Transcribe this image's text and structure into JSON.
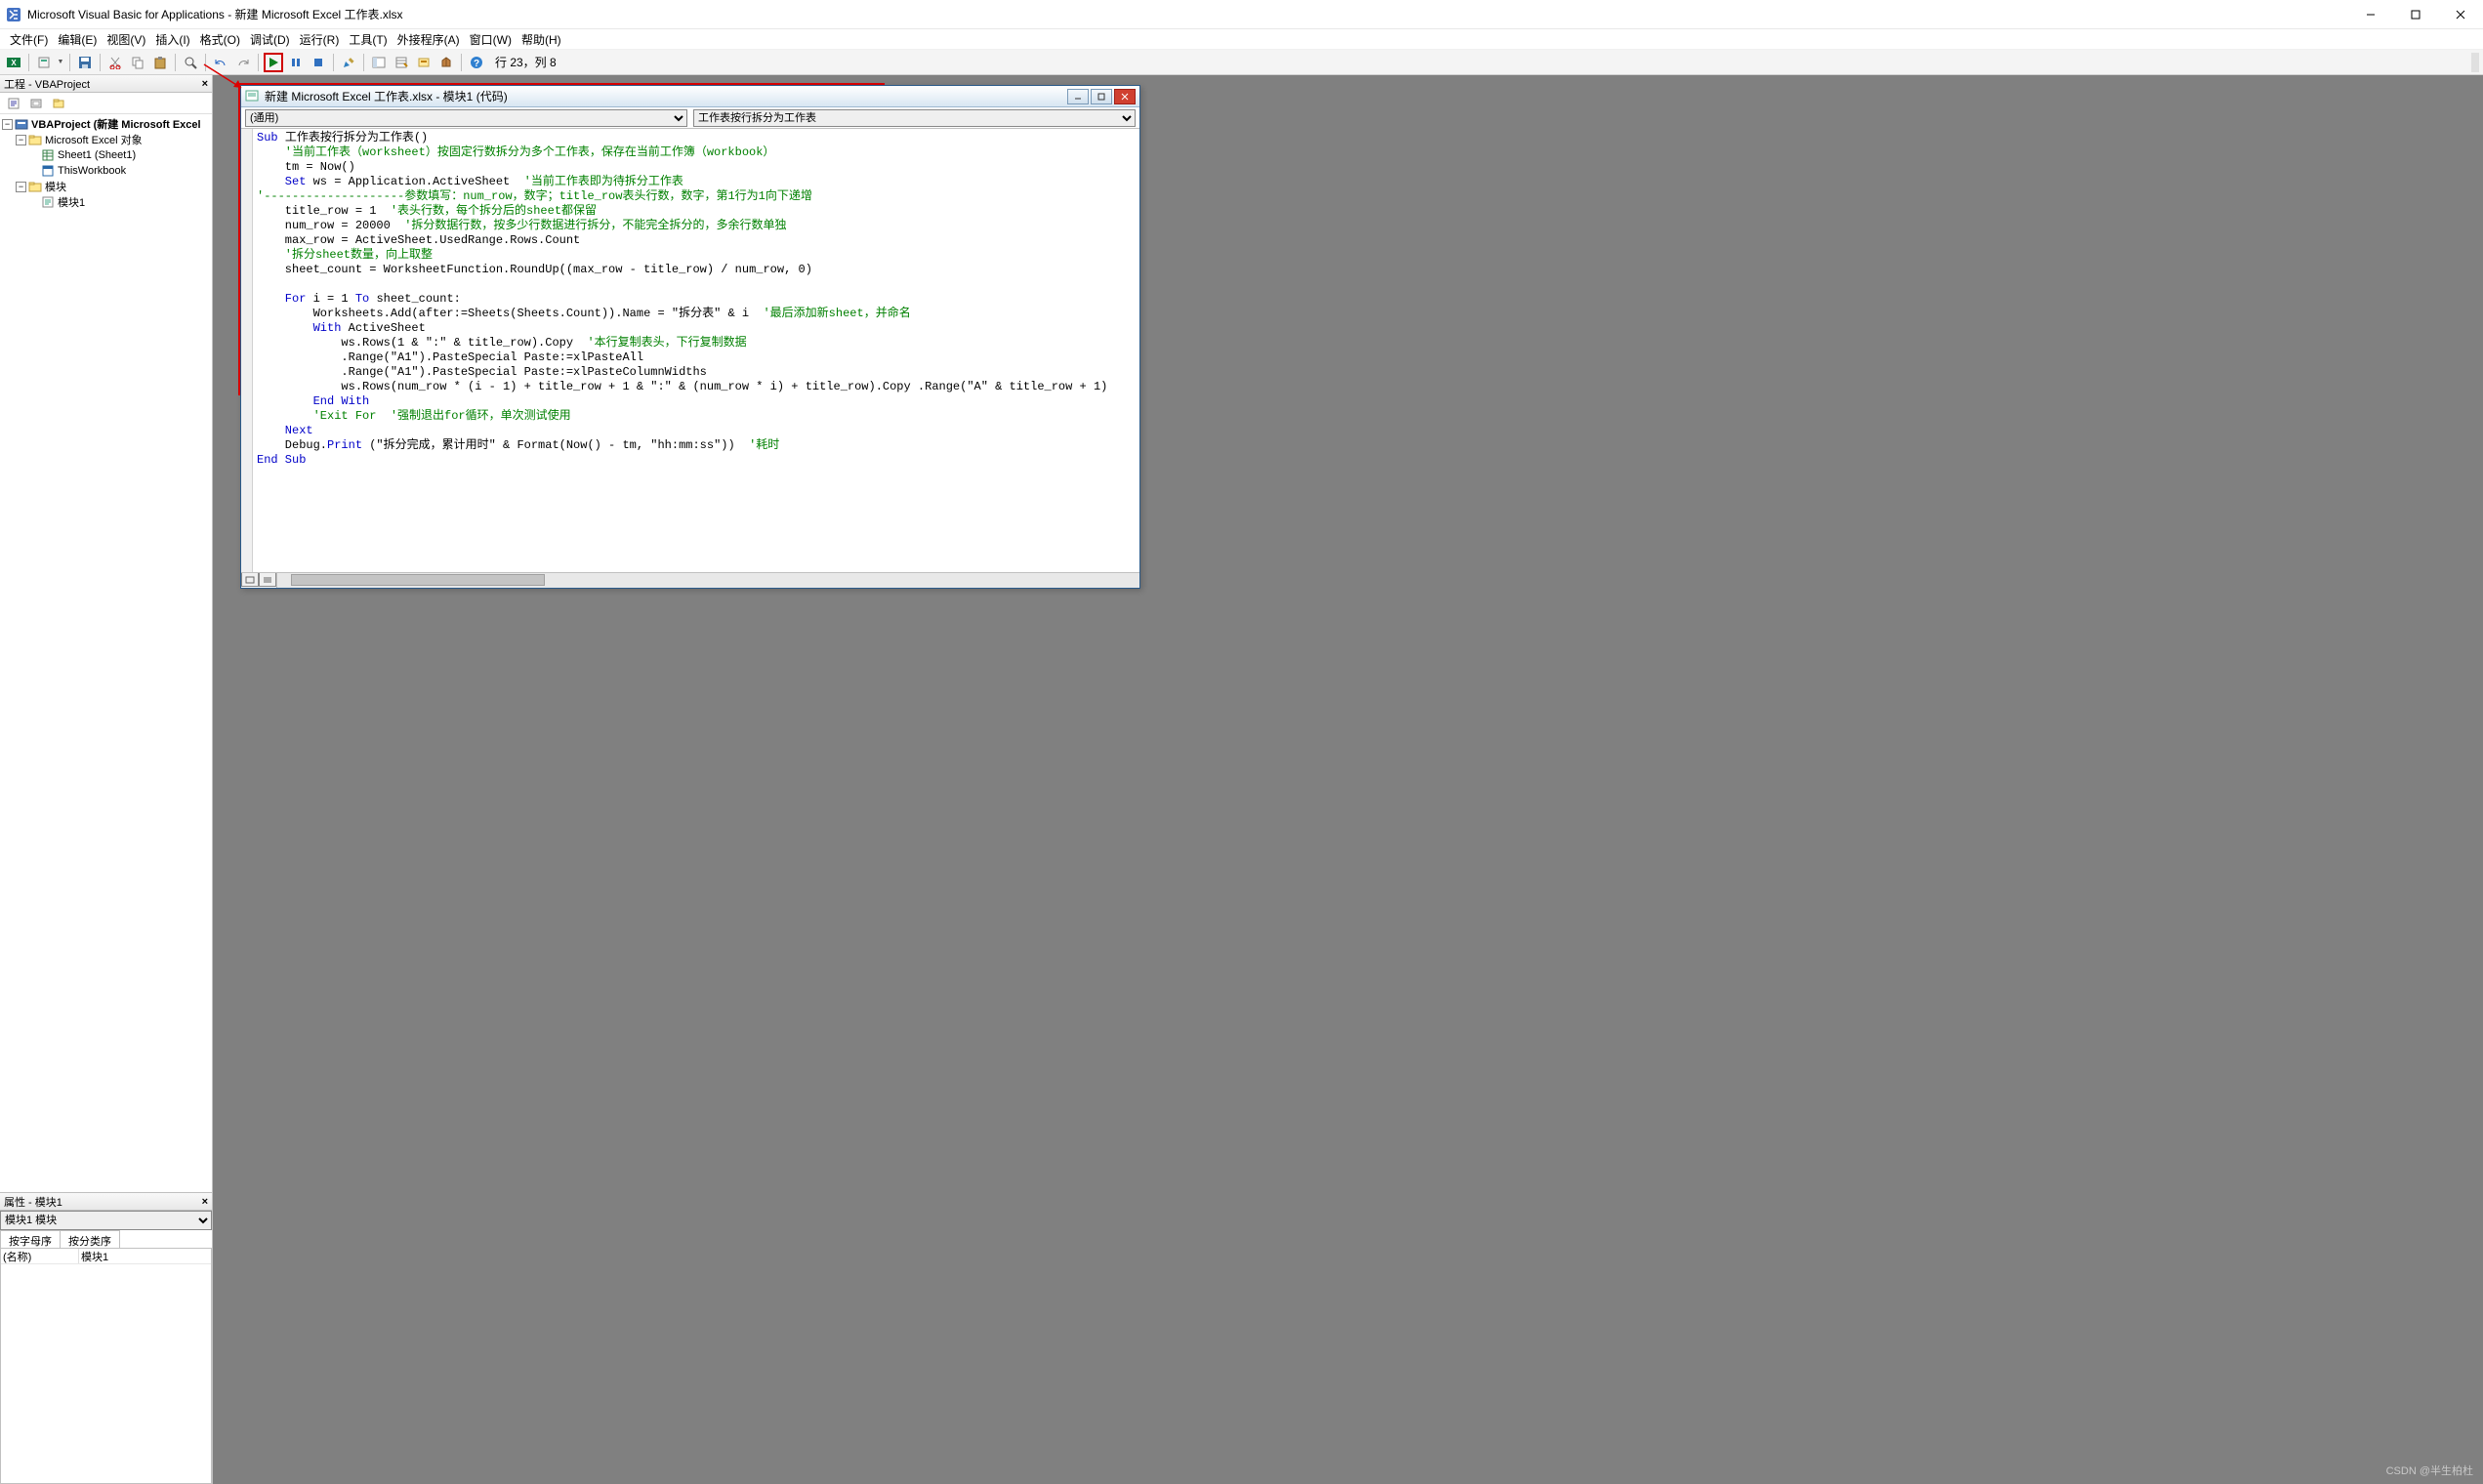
{
  "title": "Microsoft Visual Basic for Applications - 新建 Microsoft Excel 工作表.xlsx",
  "menus": {
    "file": "文件(F)",
    "edit": "编辑(E)",
    "view": "视图(V)",
    "insert": "插入(I)",
    "format": "格式(O)",
    "debug": "调试(D)",
    "run": "运行(R)",
    "tools": "工具(T)",
    "addins": "外接程序(A)",
    "window": "窗口(W)",
    "help": "帮助(H)"
  },
  "toolbar": {
    "position": "行 23，列 8"
  },
  "project_panel": {
    "title": "工程 - VBAProject",
    "root": "VBAProject (新建 Microsoft Excel",
    "folder_objects": "Microsoft Excel 对象",
    "sheet1": "Sheet1 (Sheet1)",
    "thiswb": "ThisWorkbook",
    "folder_modules": "模块",
    "module1": "模块1"
  },
  "props_panel": {
    "title": "属性 - 模块1",
    "dropdown": "模块1 模块",
    "tab_alpha": "按字母序",
    "tab_cat": "按分类序",
    "row_name_k": "(名称)",
    "row_name_v": "模块1"
  },
  "code_window": {
    "title": "新建 Microsoft Excel 工作表.xlsx - 模块1 (代码)",
    "left_dropdown": "(通用)",
    "right_dropdown": "工作表按行拆分为工作表"
  },
  "code": {
    "l01_kw": "Sub ",
    "l01_txt": "工作表按行拆分为工作表()",
    "l02": "    '当前工作表（worksheet）按固定行数拆分为多个工作表，保存在当前工作簿（workbook）",
    "l03": "    tm = Now()",
    "l04a_kw": "    Set ",
    "l04a_txt": "ws = Application.ActiveSheet  ",
    "l04a_cm": "'当前工作表即为待拆分工作表",
    "l05": "'--------------------参数填写：num_row，数字；title_row表头行数，数字，第1行为1向下递增",
    "l06_txt": "    title_row = 1  ",
    "l06_cm": "'表头行数，每个拆分后的sheet都保留",
    "l07_txt": "    num_row = 20000  ",
    "l07_cm": "'拆分数据行数，按多少行数据进行拆分，不能完全拆分的，多余行数单独",
    "l08": "    max_row = ActiveSheet.UsedRange.Rows.Count",
    "l09": "    '拆分sheet数量，向上取整",
    "l10": "    sheet_count = WorksheetFunction.RoundUp((max_row - title_row) / num_row, 0)",
    "l11": "",
    "l12_kw": "    For ",
    "l12_mid": "i = 1 ",
    "l12_kw2": "To ",
    "l12_txt": "sheet_count:",
    "l13_txt": "        Worksheets.Add(after:=Sheets(Sheets.Count)).Name = \"拆分表\" & i  ",
    "l13_cm": "'最后添加新sheet，并命名",
    "l14_kw": "        With ",
    "l14_txt": "ActiveSheet",
    "l15_txt": "            ws.Rows(1 & \":\" & title_row).Copy  ",
    "l15_cm": "'本行复制表头，下行复制数据",
    "l16": "            .Range(\"A1\").PasteSpecial Paste:=xlPasteAll",
    "l17": "            .Range(\"A1\").PasteSpecial Paste:=xlPasteColumnWidths",
    "l18": "            ws.Rows(num_row * (i - 1) + title_row + 1 & \":\" & (num_row * i) + title_row).Copy .Range(\"A\" & title_row + 1)",
    "l19_kw": "        End With",
    "l20a": "        ",
    "l20_cm": "'Exit For  '强制退出for循环，单次测试使用",
    "l21_kw": "    Next",
    "l22a": "    Debug.",
    "l22_kw": "Print ",
    "l22b": "(\"拆分完成，累计用时\" & Format(Now() - tm, \"hh:mm:ss\"))  ",
    "l22_cm": "'耗时",
    "l23_kw": "End Sub"
  },
  "watermark": "CSDN @半生柏杜"
}
